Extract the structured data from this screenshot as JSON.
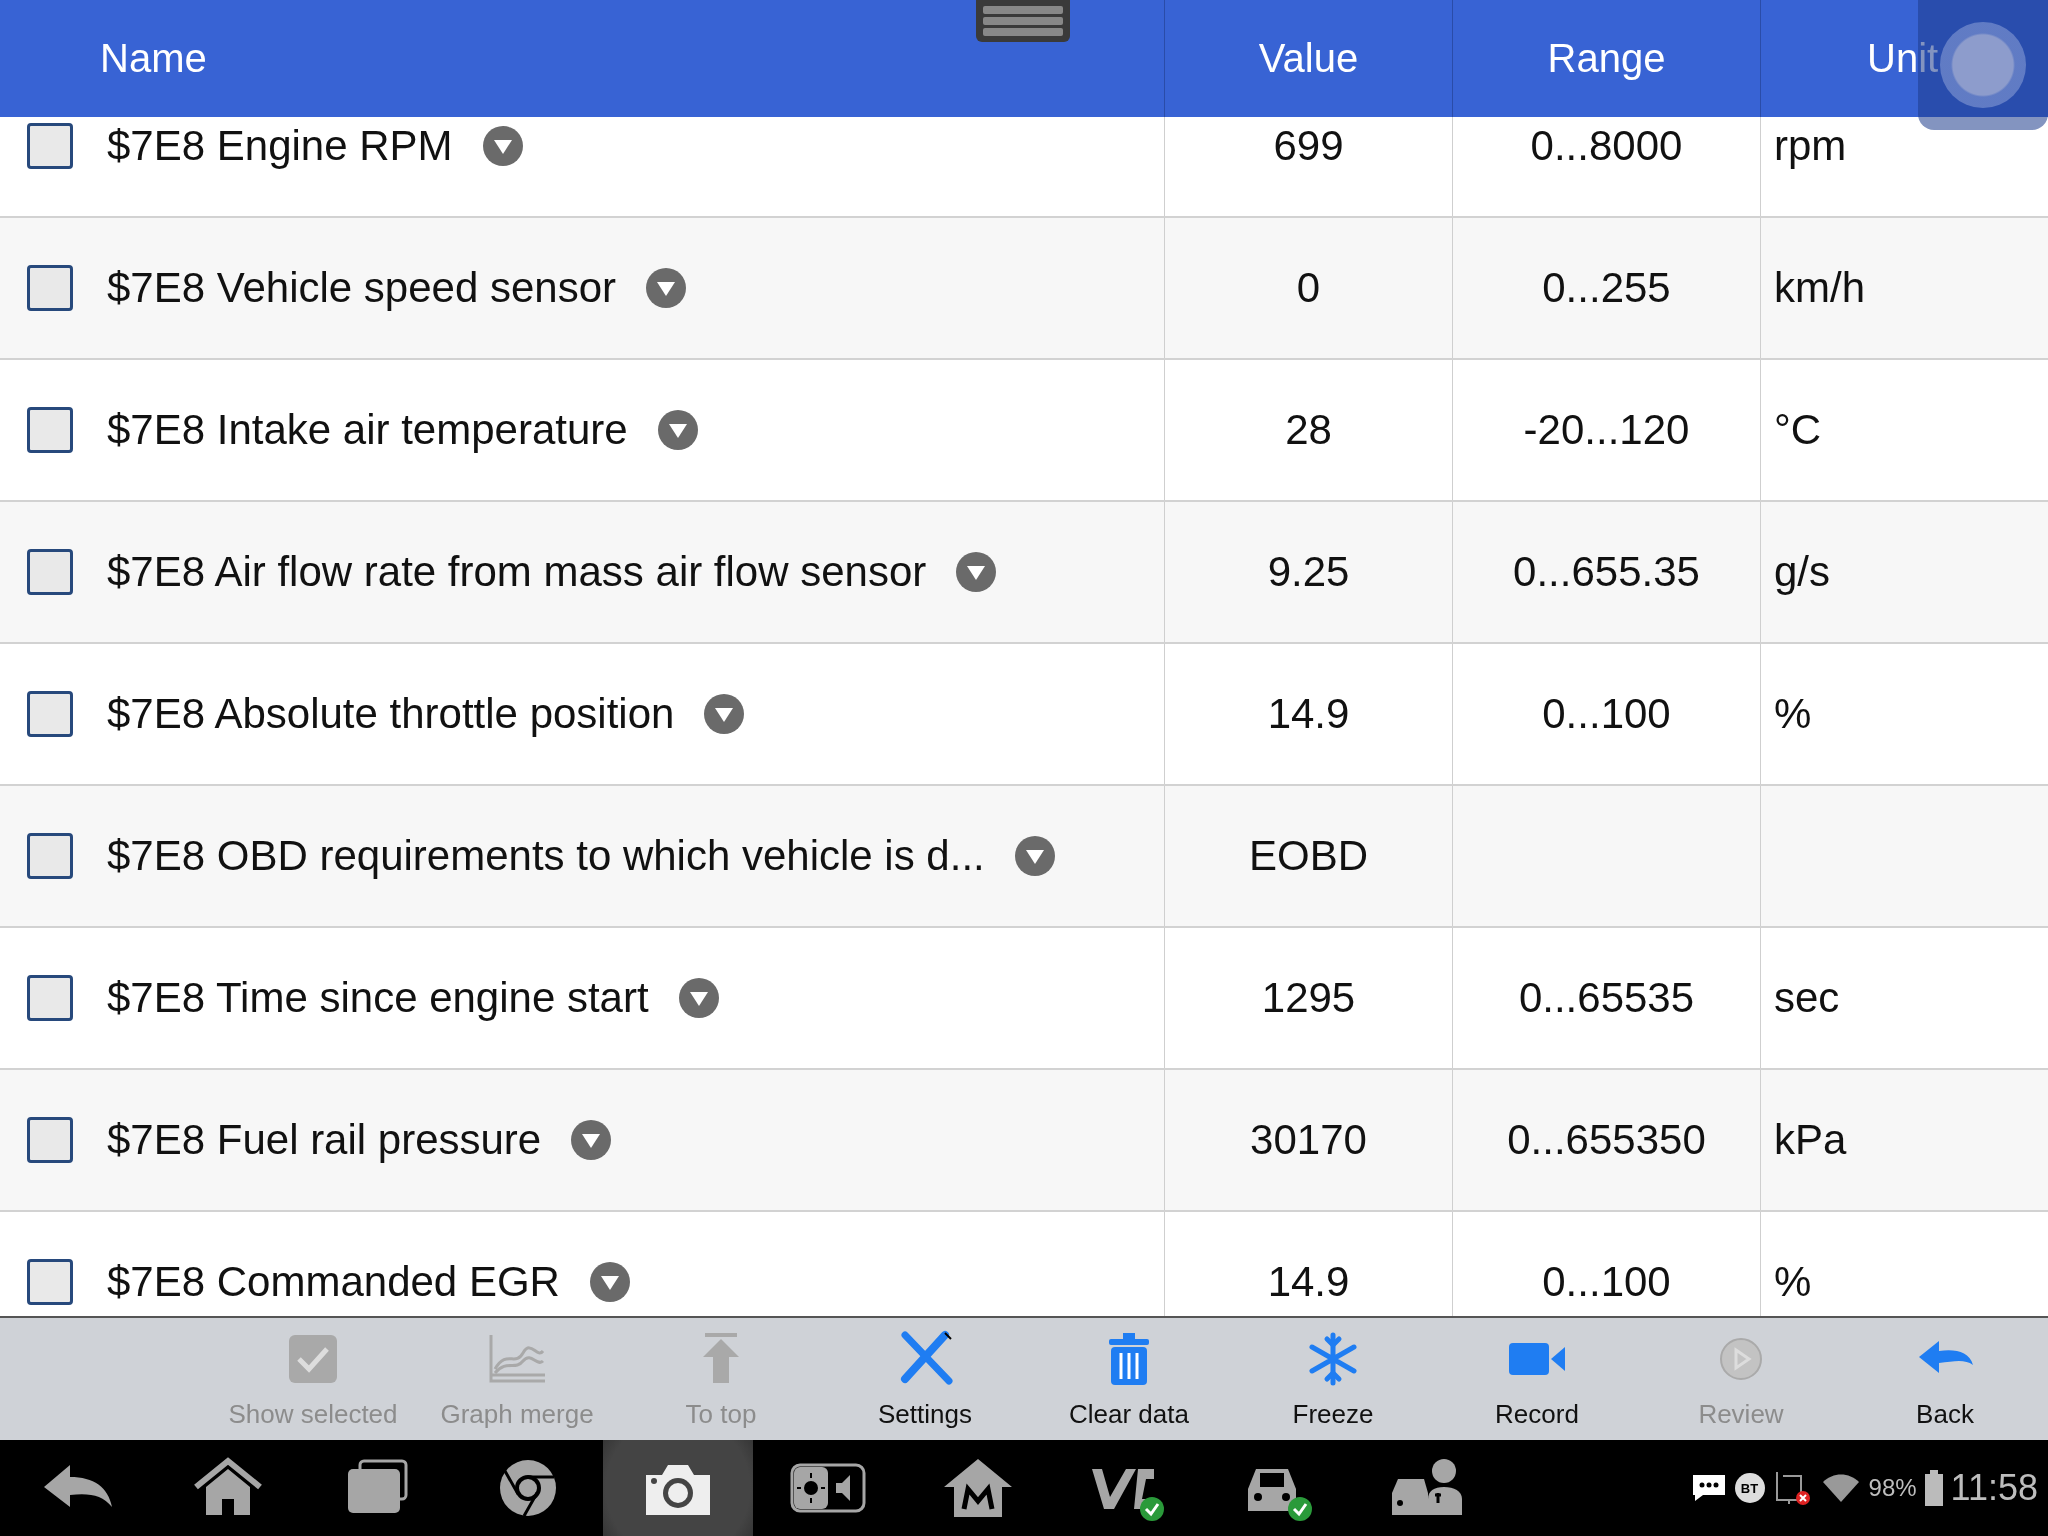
{
  "header": {
    "columns": [
      "Name",
      "Value",
      "Range",
      "Unit"
    ]
  },
  "rows": [
    {
      "name": "$7E8 Engine RPM",
      "checked": false,
      "value": "699",
      "range": "0...8000",
      "unit": "rpm"
    },
    {
      "name": "$7E8 Vehicle speed sensor",
      "checked": false,
      "value": "0",
      "range": "0...255",
      "unit": "km/h"
    },
    {
      "name": "$7E8 Intake air temperature",
      "checked": false,
      "value": "28",
      "range": "-20...120",
      "unit": "°C"
    },
    {
      "name": "$7E8 Air flow rate from mass air flow sensor",
      "checked": false,
      "value": "9.25",
      "range": "0...655.35",
      "unit": "g/s"
    },
    {
      "name": "$7E8 Absolute throttle position",
      "checked": false,
      "value": "14.9",
      "range": "0...100",
      "unit": "%"
    },
    {
      "name": "$7E8 OBD requirements to which vehicle is d...",
      "checked": false,
      "value": "EOBD"
    },
    {
      "name": "$7E8 Time since engine start",
      "checked": false,
      "value": "1295",
      "range": "0...65535",
      "unit": "sec"
    },
    {
      "name": "$7E8 Fuel rail pressure",
      "checked": false,
      "value": "30170",
      "range": "0...655350",
      "unit": "kPa"
    },
    {
      "name": "$7E8 Commanded EGR",
      "checked": false,
      "value": "14.9",
      "range": "0...100",
      "unit": "%"
    }
  ],
  "toolbar": [
    {
      "kind": "check",
      "label": "Show selected",
      "disabled": true
    },
    {
      "kind": "graph",
      "label": "Graph merge",
      "disabled": true
    },
    {
      "kind": "top",
      "label": "To top",
      "disabled": true
    },
    {
      "kind": "settings",
      "label": "Settings",
      "disabled": false
    },
    {
      "kind": "trash",
      "label": "Clear data",
      "disabled": false
    },
    {
      "kind": "freeze",
      "label": "Freeze",
      "disabled": false
    },
    {
      "kind": "record",
      "label": "Record",
      "disabled": false
    },
    {
      "kind": "review",
      "label": "Review",
      "disabled": true
    },
    {
      "kind": "back",
      "label": "Back",
      "disabled": false
    }
  ],
  "nav_bar": [
    {
      "kind": "back",
      "selected": false
    },
    {
      "kind": "home",
      "selected": false
    },
    {
      "kind": "recents",
      "selected": false
    },
    {
      "kind": "browser",
      "selected": false
    },
    {
      "kind": "camera",
      "selected": true
    },
    {
      "kind": "brightness",
      "selected": false
    },
    {
      "kind": "maintenance",
      "selected": false
    },
    {
      "kind": "vci",
      "selected": false
    },
    {
      "kind": "vehicle",
      "selected": false
    },
    {
      "kind": "remote",
      "selected": false
    }
  ],
  "status_bar": {
    "bluetooth": "BT",
    "battery": "98%",
    "time": "11:58"
  }
}
